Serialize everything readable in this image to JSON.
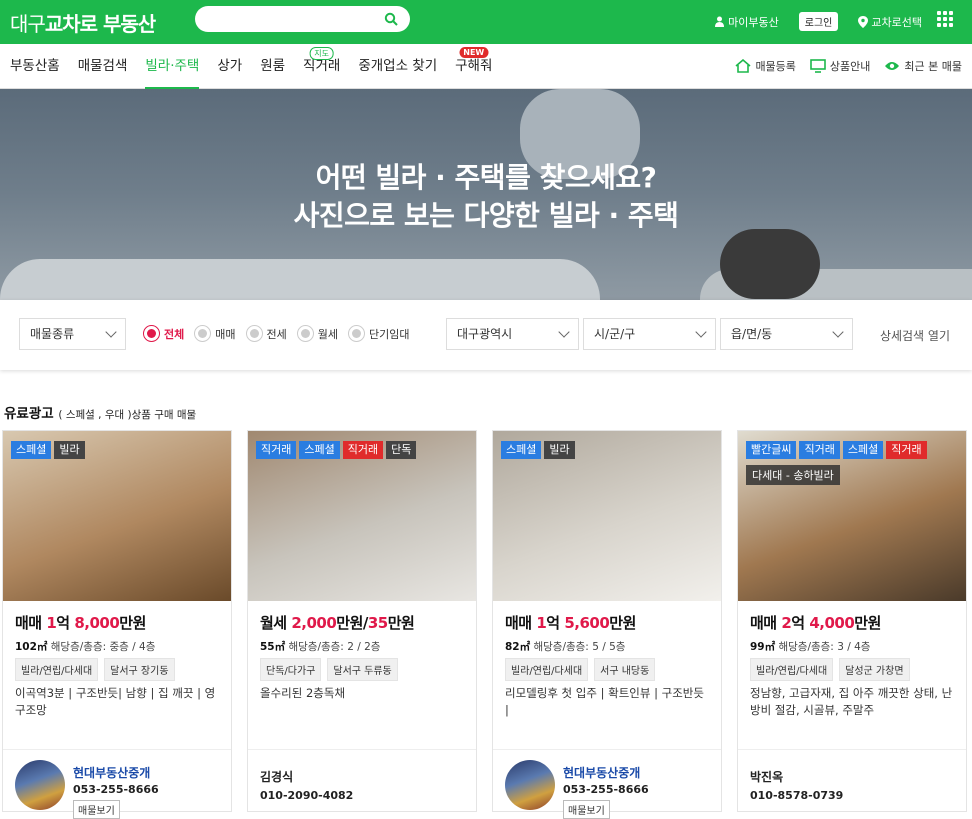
{
  "header": {
    "logo_prefix": "대구",
    "logo_brand": "교차로 부동산",
    "search_value": "",
    "my_label": "마이부동산",
    "login_label": "로그인",
    "region_label": "교차로선택",
    "accent": "#1db84c"
  },
  "nav": {
    "items": [
      {
        "label": "부동산홈",
        "badge": ""
      },
      {
        "label": "매물검색",
        "badge": ""
      },
      {
        "label": "빌라·주택",
        "badge": ""
      },
      {
        "label": "상가",
        "badge": ""
      },
      {
        "label": "원룸",
        "badge": ""
      },
      {
        "label": "직거래",
        "badge": "지도"
      },
      {
        "label": "중개업소 찾기",
        "badge": ""
      },
      {
        "label": "구해줘",
        "badge": "NEW"
      }
    ],
    "active_index": 2,
    "right": {
      "register": "매물등록",
      "product": "상품안내",
      "recent": "최근 본 매물"
    }
  },
  "hero": {
    "line1": "어떤 빌라 · 주택를 찾으세요?",
    "line2": "사진으로 보는 다양한 빌라 · 주택"
  },
  "filters": {
    "type_select": "매물종류",
    "radios": [
      "전체",
      "매매",
      "전세",
      "월세",
      "단기임대"
    ],
    "radio_selected": 0,
    "city_select": "대구광역시",
    "district_select": "시/군/구",
    "town_select": "읍/면/동",
    "detail_label": "상세검색 열기"
  },
  "section": {
    "title": "유료광고",
    "subtitle": "( 스페셜 , 우대 )상품 구매 매물"
  },
  "cards": [
    {
      "badges": [
        {
          "t": "스페셜",
          "c": "blue"
        },
        {
          "t": "빌라",
          "c": "dark"
        }
      ],
      "subtitle": "",
      "price_type": "매매",
      "price_parts": [
        {
          "t": " 1",
          "r": true
        },
        {
          "t": "억 ",
          "r": false
        },
        {
          "t": "8,000",
          "r": true
        },
        {
          "t": "만원",
          "r": false
        }
      ],
      "area": "102㎡",
      "floor_label": "해당층/총층:",
      "floor": "중층 / 4층",
      "chips": [
        "빌라/연립/다세대",
        "달서구 장기동"
      ],
      "desc": "이곡역3분 | 구조반듯| 남향 | 집 깨끗 | 영구조망",
      "agent": {
        "name": "현대부동산중개",
        "phone": "053-255-8666",
        "btn": "매물보기"
      },
      "person": null,
      "photo": [
        "#6a4a2a",
        "#b08860",
        "#d8c8b0"
      ]
    },
    {
      "badges": [
        {
          "t": "직거래",
          "c": "blue"
        },
        {
          "t": "스페셜",
          "c": "blue"
        },
        {
          "t": "직거래",
          "c": "red"
        },
        {
          "t": "단독",
          "c": "dark"
        }
      ],
      "subtitle": "",
      "price_type": "월세",
      "price_parts": [
        {
          "t": " 2,000",
          "r": true
        },
        {
          "t": "만원/",
          "r": false
        },
        {
          "t": "35",
          "r": true
        },
        {
          "t": "만원",
          "r": false
        }
      ],
      "area": "55㎡",
      "floor_label": "해당층/총층:",
      "floor": "2 / 2층",
      "chips": [
        "단독/다가구",
        "달서구 두류동"
      ],
      "desc": "올수리된 2층독채",
      "agent": null,
      "person": {
        "name": "김경식",
        "phone": "010-2090-4082"
      },
      "photo": [
        "#e8e6e2",
        "#c8c4bc",
        "#a08870"
      ]
    },
    {
      "badges": [
        {
          "t": "스페셜",
          "c": "blue"
        },
        {
          "t": "빌라",
          "c": "dark"
        }
      ],
      "subtitle": "",
      "price_type": "매매",
      "price_parts": [
        {
          "t": " 1",
          "r": true
        },
        {
          "t": "억 ",
          "r": false
        },
        {
          "t": "5,600",
          "r": true
        },
        {
          "t": "만원",
          "r": false
        }
      ],
      "area": "82㎡",
      "floor_label": "해당층/총층:",
      "floor": "5 / 5층",
      "chips": [
        "빌라/연립/다세대",
        "서구 내당동"
      ],
      "desc": "리모델링후 첫 입주 | 확트인뷰 | 구조반듯 |",
      "agent": {
        "name": "현대부동산중개",
        "phone": "053-255-8666",
        "btn": "매물보기"
      },
      "person": null,
      "photo": [
        "#f2f0ec",
        "#d8d4cc",
        "#b0a89c"
      ]
    },
    {
      "badges": [
        {
          "t": "빨간글씨",
          "c": "blue"
        },
        {
          "t": "직거래",
          "c": "blue"
        },
        {
          "t": "스페셜",
          "c": "blue"
        },
        {
          "t": "직거래",
          "c": "red"
        }
      ],
      "subtitle": "다세대 - 송하빌라",
      "price_type": "매매",
      "price_parts": [
        {
          "t": " 2",
          "r": true
        },
        {
          "t": "억 ",
          "r": false
        },
        {
          "t": "4,000",
          "r": true
        },
        {
          "t": "만원",
          "r": false
        }
      ],
      "area": "99㎡",
      "floor_label": "해당층/총층:",
      "floor": "3 / 4층",
      "chips": [
        "빌라/연립/다세대",
        "달성군 가창면"
      ],
      "desc": "정남향, 고급자재, 집 아주 깨끗한 상태, 난방비 절감, 시골뷰, 주말주",
      "agent": null,
      "person": {
        "name": "박진옥",
        "phone": "010-8578-0739"
      },
      "photo": [
        "#4a3a2a",
        "#a07850",
        "#e0dcd0"
      ]
    }
  ]
}
